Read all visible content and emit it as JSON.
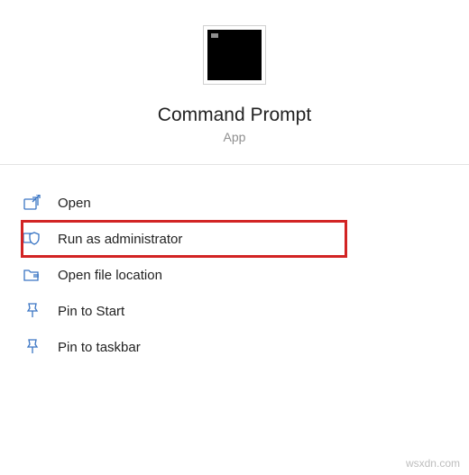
{
  "app": {
    "title": "Command Prompt",
    "type": "App"
  },
  "actions": {
    "open": "Open",
    "run_as_admin": "Run as administrator",
    "open_file_location": "Open file location",
    "pin_to_start": "Pin to Start",
    "pin_to_taskbar": "Pin to taskbar"
  },
  "watermark": "wsxdn.com"
}
